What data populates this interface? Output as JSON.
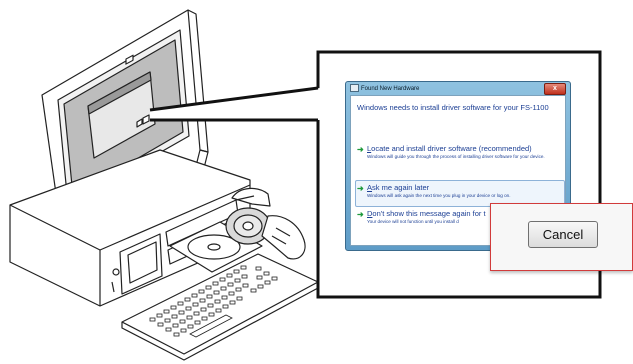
{
  "dialog": {
    "title": "Found New Hardware",
    "close_glyph": "x",
    "heading": "Windows needs to install driver software for your FS-1100",
    "options": [
      {
        "icon": "green-arrow-icon",
        "title": "Locate and install driver software (recommended)",
        "title_underline": "L",
        "title_rest": "ocate and install driver software (recommended)",
        "description": "Windows will guide you through the process of installing driver software for your device."
      },
      {
        "icon": "green-arrow-icon",
        "title": "Ask me again later",
        "title_underline": "A",
        "title_rest": "sk me again later",
        "description": "Windows will ask again the next time you plug in your device or log on."
      },
      {
        "icon": "green-arrow-icon",
        "title": "Don't show this message again for",
        "title_underline": "D",
        "title_rest": "on't show this message again for t",
        "description": "Your device will not function until you install d"
      }
    ]
  },
  "zoom": {
    "cancel_label": "Cancel"
  },
  "colors": {
    "dialog_text": "#1c3f94",
    "title_bar": "#5e9cc7",
    "callout_border": "#d13b3b",
    "arrow": "#1f9a3c"
  }
}
